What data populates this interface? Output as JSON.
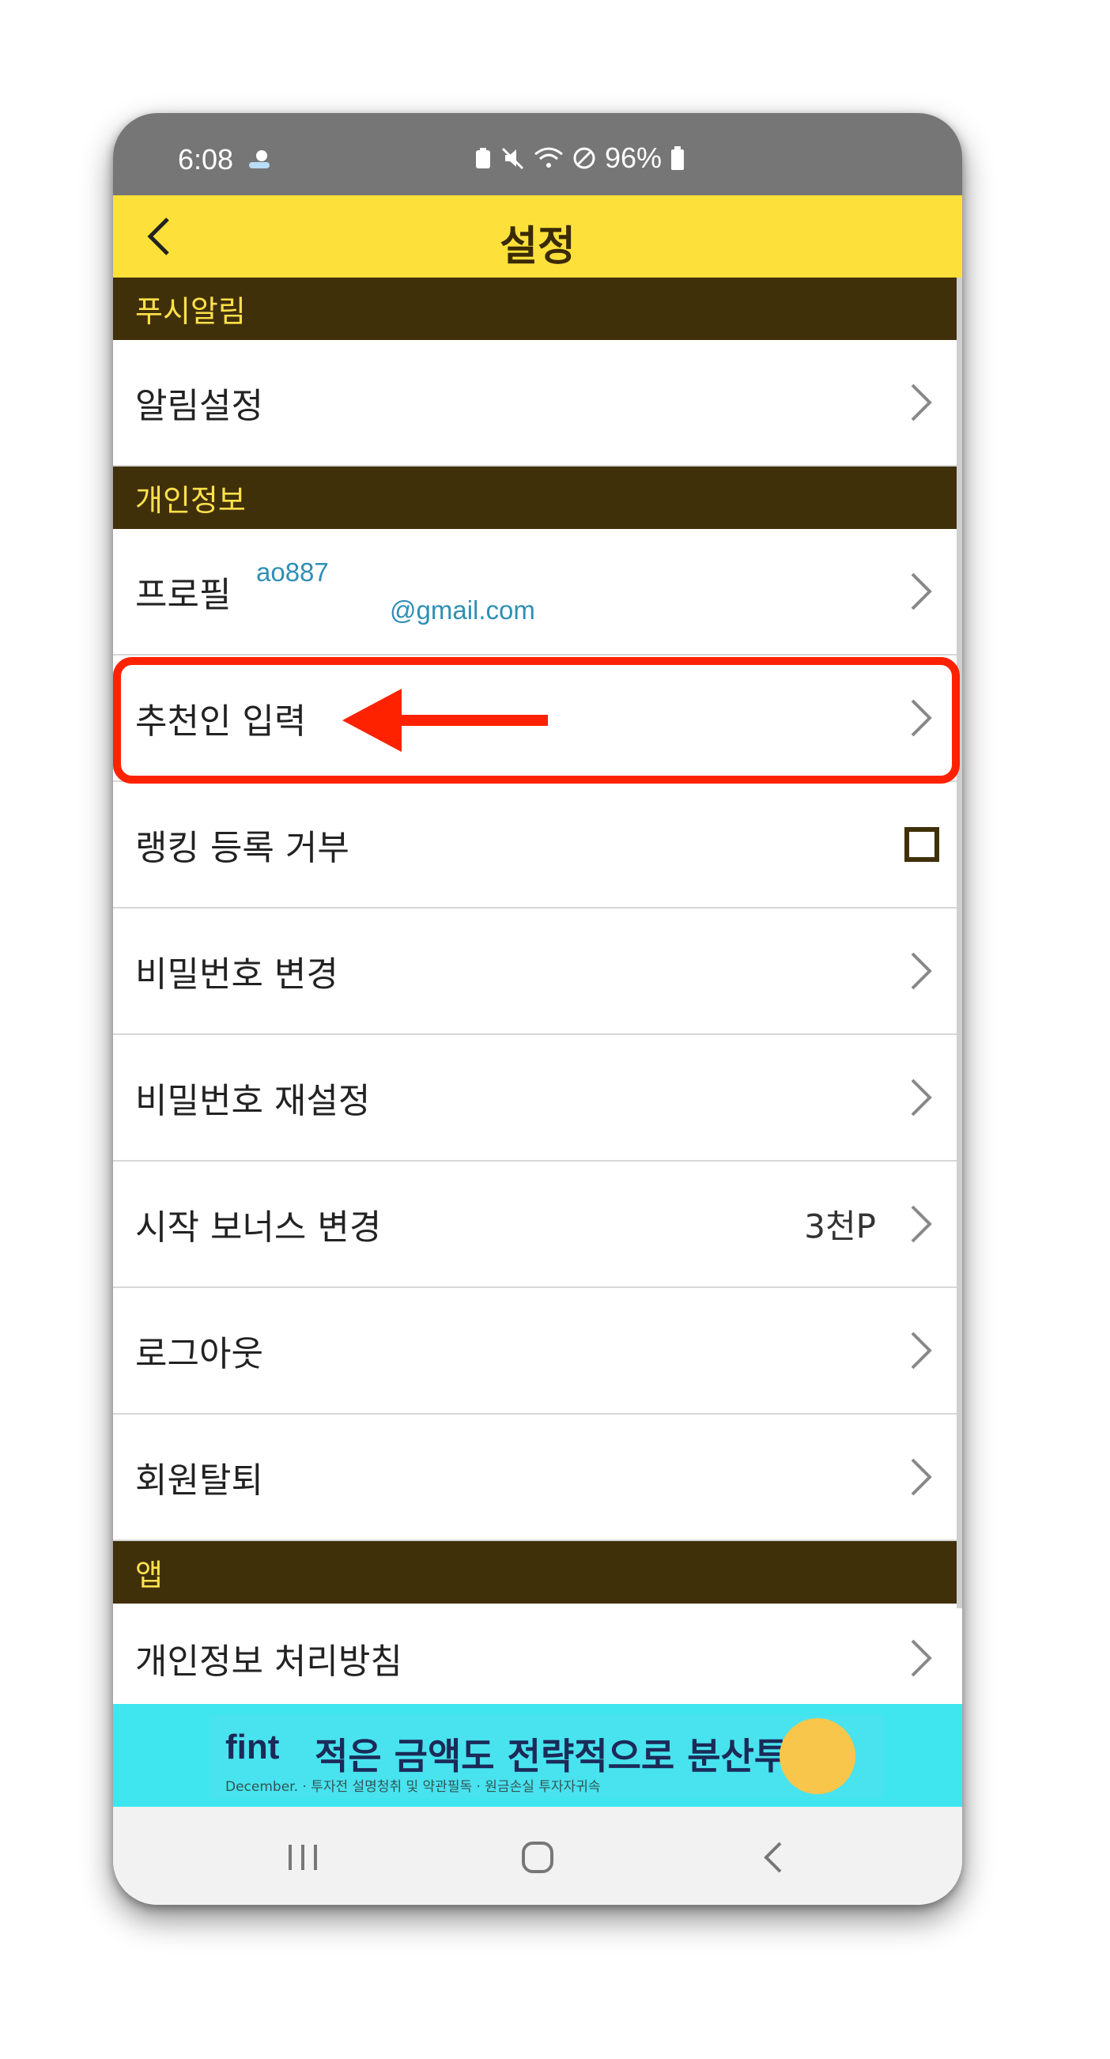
{
  "status_bar": {
    "time": "6:08",
    "battery": "96%"
  },
  "app_bar": {
    "title": "설정"
  },
  "sections": {
    "push": "푸시알림",
    "personal": "개인정보",
    "app": "앱"
  },
  "items": {
    "notification_settings": "알림설정",
    "profile": "프로필",
    "profile_email_line1": "ao887",
    "profile_email_line2": "@gmail.com",
    "referrer_input": "추천인 입력",
    "ranking_opt_out": "랭킹 등록 거부",
    "change_password": "비밀번호 변경",
    "reset_password": "비밀번호 재설정",
    "start_bonus": "시작 보너스 변경",
    "start_bonus_value": "3천P",
    "logout": "로그아웃",
    "withdraw": "회원탈퇴",
    "privacy_policy": "개인정보 처리방침"
  },
  "ad_banner": {
    "logo": "fint",
    "headline": "적은 금액도 전략적으로 분산투자",
    "subtext": "December. · 투자전 설명청취 및 약관필독 · 원금손실 투자자귀속"
  },
  "colors": {
    "accent_yellow": "#fde13a",
    "section_brown": "#40300a",
    "highlight_red": "#ff2200"
  }
}
